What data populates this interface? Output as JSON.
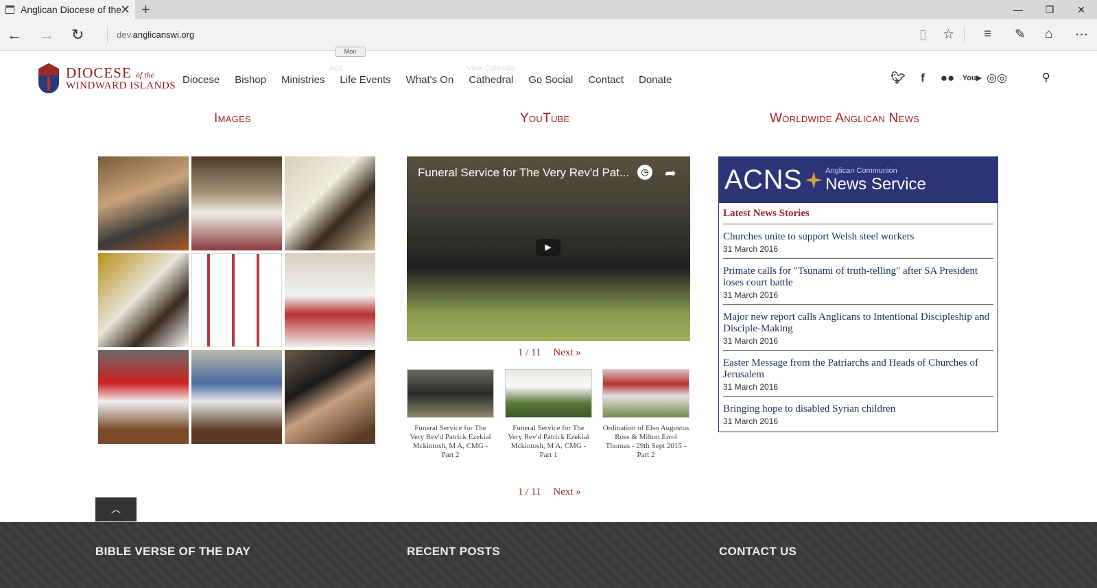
{
  "browser": {
    "tab_title": "Anglican Diocese of the",
    "url_prefix": "dev.",
    "url_domain": "anglicanswi.org"
  },
  "site": {
    "logo_line1": "Diocese",
    "logo_ofthe": "of the",
    "logo_line2": "Windward Islands",
    "nav": [
      "Diocese",
      "Bishop",
      "Ministries",
      "Life Events",
      "What's On",
      "Cathedral",
      "Go Social",
      "Contact",
      "Donate"
    ],
    "ghost": {
      "mon": "Mon",
      "add": "Add",
      "view_calendar": "View Calendar"
    },
    "social_icons": [
      "twitter-icon",
      "facebook-icon",
      "flickr-icon",
      "youtube-icon",
      "tripadvisor-icon"
    ]
  },
  "columns": {
    "images_title": "Images",
    "youtube_title": "YouTube",
    "news_title": "Worldwide Anglican News"
  },
  "video": {
    "title": "Funeral Service for The Very Rev'd Pat..."
  },
  "pager": {
    "page": "1 / 11",
    "next": "Next »"
  },
  "thumbs": [
    {
      "caption": "Funeral Service for The Very Rev'd Patrick Ezekial Mckintosh, M A, CMG - Part 2"
    },
    {
      "caption": "Funeral Service for The Very Rev'd Patrick Ezekial Mckintosh, M A, CMG - Part 1"
    },
    {
      "caption": "Ordination of Elso Augustus Ross & Milton Errol Thomas - 29th Sept 2015 - Part 2"
    }
  ],
  "acns": {
    "logo_big": "ACNS",
    "logo_small": "Anglican Communion",
    "logo_sub": "News Service",
    "latest": "Latest News Stories",
    "items": [
      {
        "title": "Churches unite to support Welsh steel workers",
        "date": "31 March 2016"
      },
      {
        "title": "Primate calls for \"Tsunami of truth-telling\" after SA President loses court battle",
        "date": "31 March 2016"
      },
      {
        "title": "Major new report calls Anglicans to Intentional Discipleship and Disciple-Making",
        "date": "31 March 2016"
      },
      {
        "title": "Easter Message from the Patriarchs and Heads of Churches of Jerusalem",
        "date": "31 March 2016"
      },
      {
        "title": "Bringing hope to disabled Syrian children",
        "date": "31 March 2016"
      }
    ]
  },
  "footer": {
    "bible_verse": "BIBLE VERSE OF THE DAY",
    "recent_posts": "RECENT POSTS",
    "contact_us": "CONTACT US"
  }
}
